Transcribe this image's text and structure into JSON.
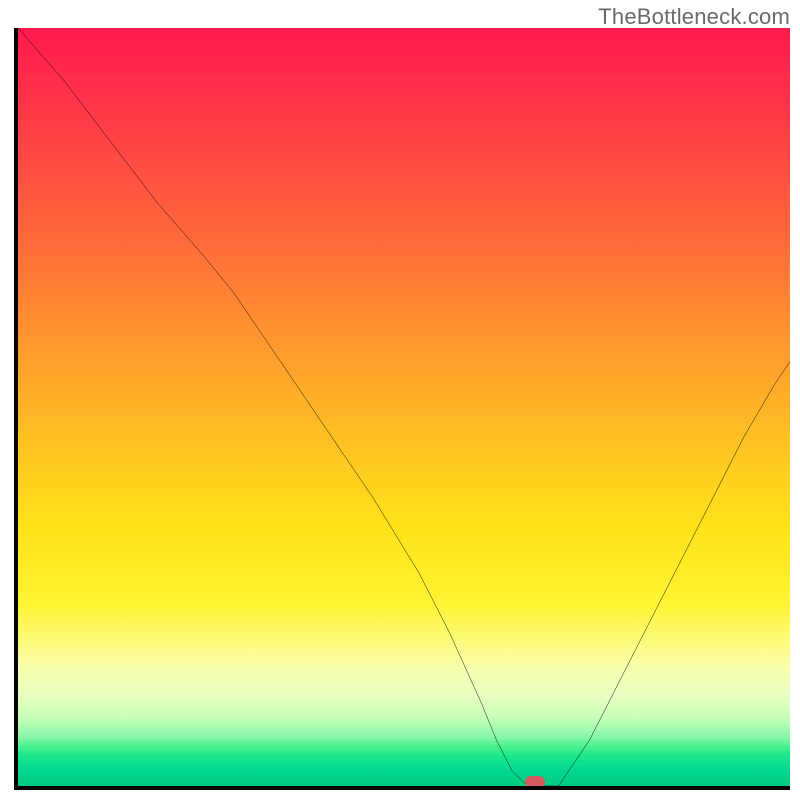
{
  "watermark": "TheBottleneck.com",
  "colors": {
    "axis": "#000000",
    "curve": "#000000",
    "marker": "#d65a5f"
  },
  "chart_data": {
    "type": "line",
    "title": "",
    "xlabel": "",
    "ylabel": "",
    "xlim": [
      0,
      100
    ],
    "ylim": [
      0,
      100
    ],
    "grid": false,
    "legend": null,
    "series": [
      {
        "name": "bottleneck-curve",
        "x": [
          0,
          6,
          12,
          18,
          24,
          28,
          34,
          40,
          46,
          52,
          56,
          60,
          62,
          64,
          66,
          70,
          74,
          78,
          82,
          86,
          90,
          94,
          98,
          100
        ],
        "y": [
          100,
          93,
          85,
          77,
          70,
          65,
          56,
          47,
          38,
          28,
          20,
          11,
          6,
          2,
          0,
          0,
          6,
          14,
          22,
          30,
          38,
          46,
          53,
          56
        ]
      }
    ],
    "marker": {
      "x": 67,
      "y": 0.5,
      "shape": "pill",
      "color": "#d65a5f"
    },
    "background_gradient": [
      {
        "stop": 0.0,
        "color": "#ff1a4e"
      },
      {
        "stop": 0.28,
        "color": "#ff6a3a"
      },
      {
        "stop": 0.55,
        "color": "#ffc322"
      },
      {
        "stop": 0.76,
        "color": "#fff432"
      },
      {
        "stop": 0.88,
        "color": "#e8ffc2"
      },
      {
        "stop": 0.95,
        "color": "#3cf089"
      },
      {
        "stop": 1.0,
        "color": "#00c97f"
      }
    ]
  }
}
